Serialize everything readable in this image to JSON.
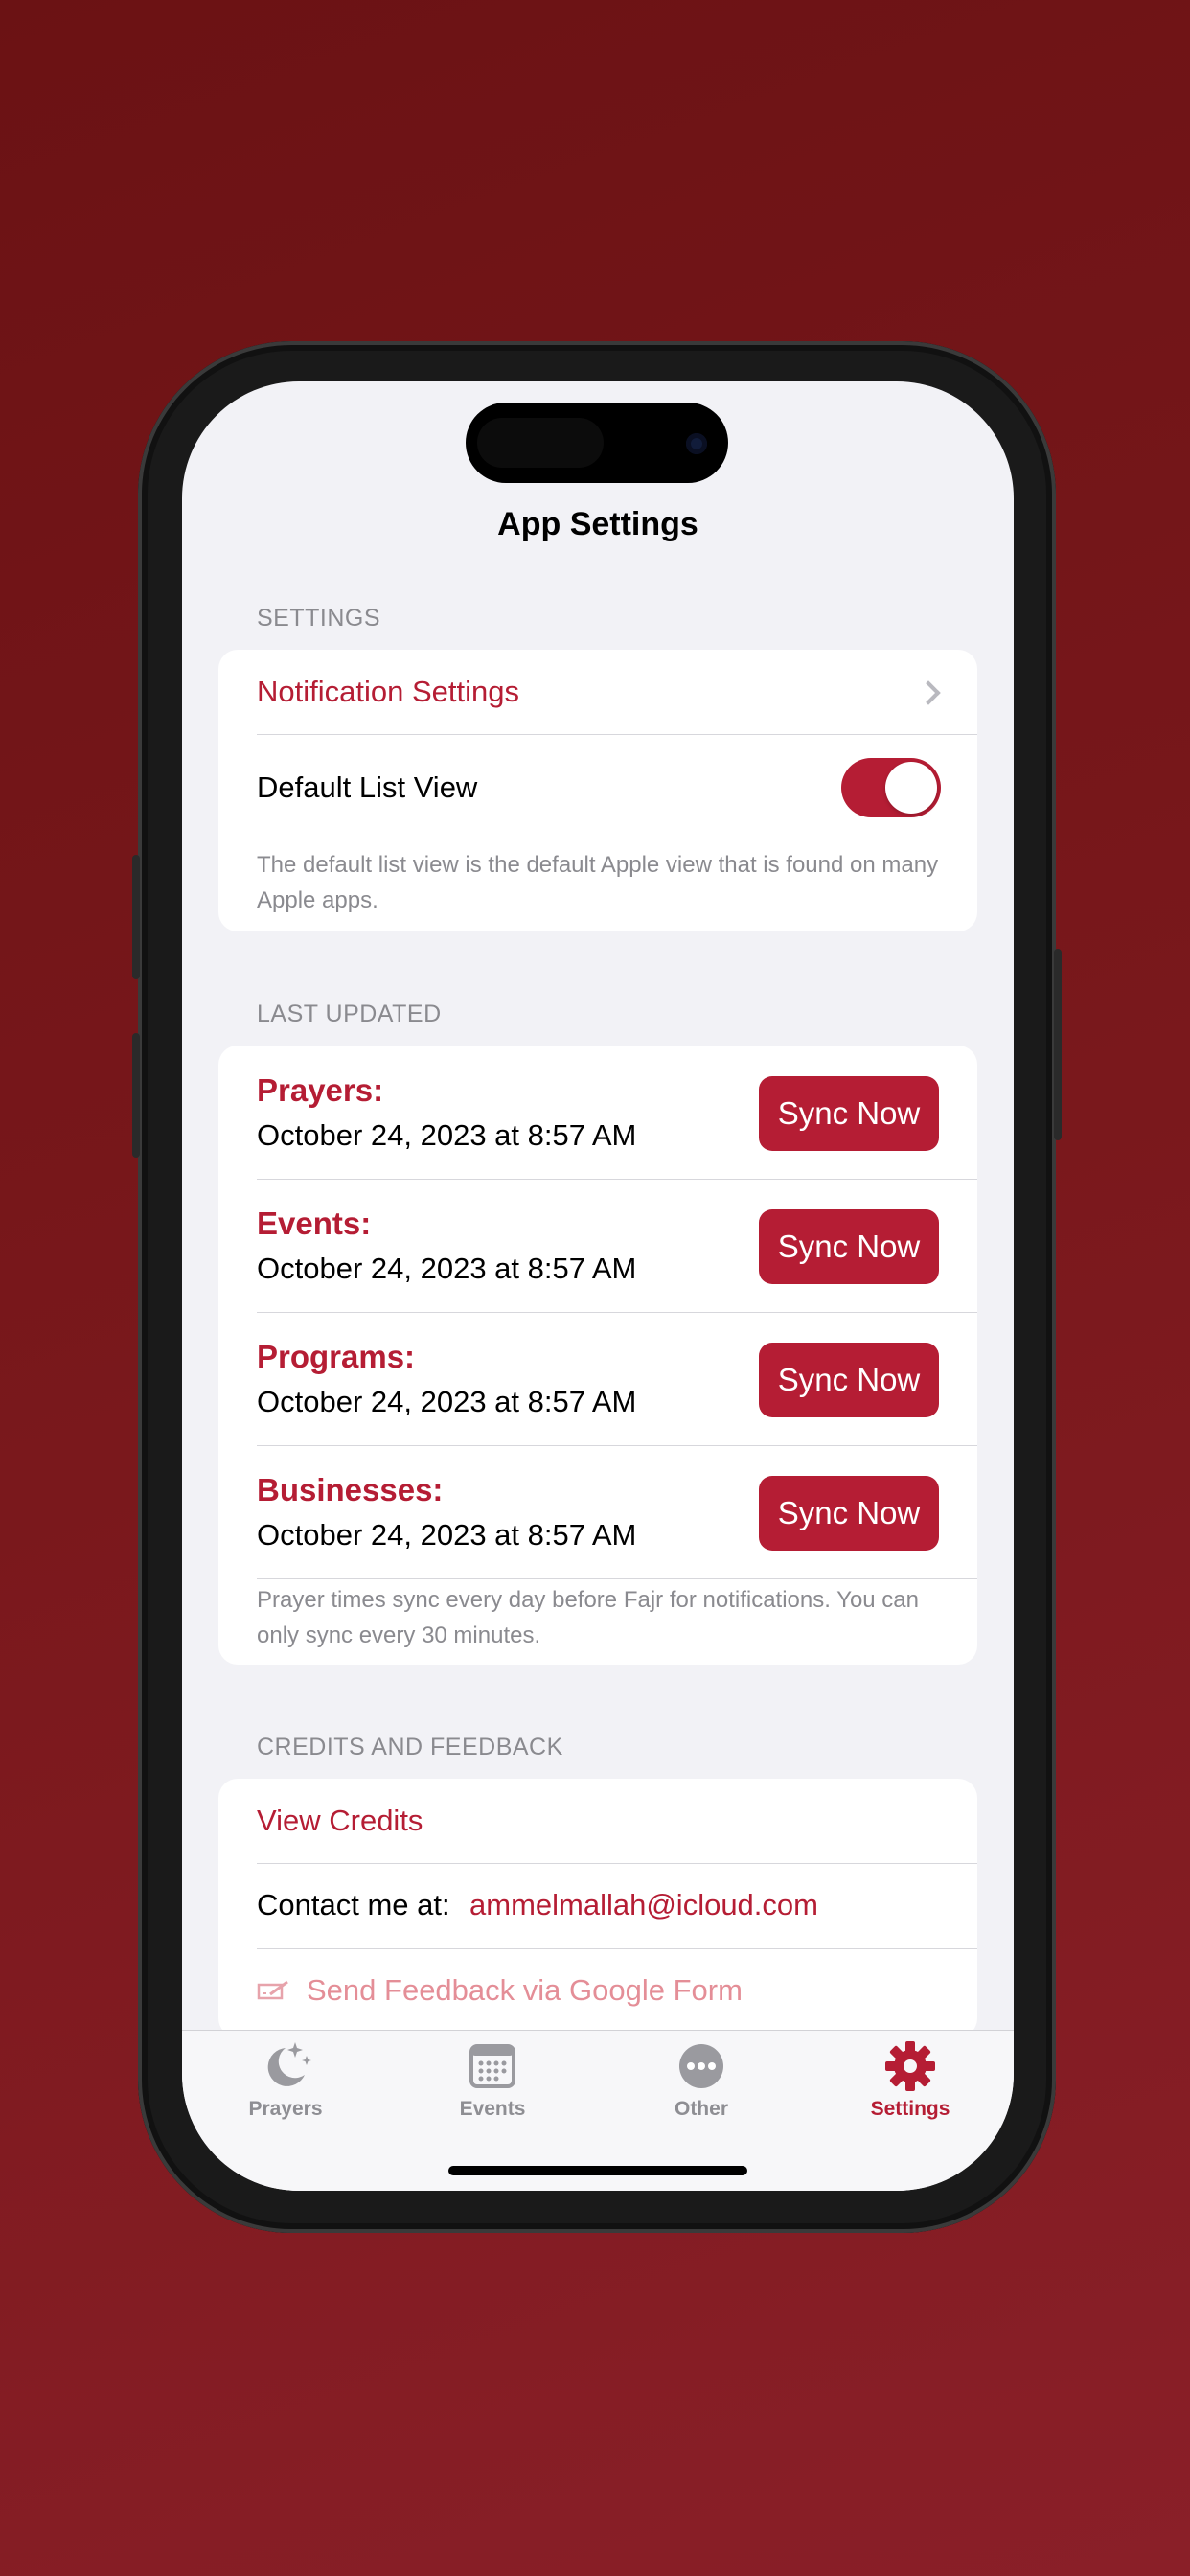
{
  "title": "App Settings",
  "settings": {
    "header": "SETTINGS",
    "notification_label": "Notification Settings",
    "default_list_label": "Default List View",
    "default_list_on": true,
    "default_list_note": "The default list view is the default Apple view that is found on many Apple apps."
  },
  "last_updated": {
    "header": "LAST UPDATED",
    "items": [
      {
        "label": "Prayers:",
        "date": "October 24, 2023 at 8:57 AM",
        "button": "Sync Now"
      },
      {
        "label": "Events:",
        "date": "October 24, 2023 at 8:57 AM",
        "button": "Sync Now"
      },
      {
        "label": "Programs:",
        "date": "October 24, 2023 at 8:57 AM",
        "button": "Sync Now"
      },
      {
        "label": "Businesses:",
        "date": "October 24, 2023 at 8:57 AM",
        "button": "Sync Now"
      }
    ],
    "note": "Prayer times sync every day before Fajr for notifications. You can only sync every 30 minutes."
  },
  "credits": {
    "header": "CREDITS AND FEEDBACK",
    "view_credits": "View Credits",
    "contact_label": "Contact me at:",
    "contact_email": "ammelmallah@icloud.com",
    "feedback_label": "Send Feedback via Google Form"
  },
  "tabs": [
    {
      "label": "Prayers",
      "icon": "moon-stars-icon"
    },
    {
      "label": "Events",
      "icon": "calendar-icon"
    },
    {
      "label": "Other",
      "icon": "ellipsis-circle-icon"
    },
    {
      "label": "Settings",
      "icon": "gear-icon",
      "active": true
    }
  ],
  "colors": {
    "accent": "#b51d34",
    "background": "#7a181c"
  }
}
